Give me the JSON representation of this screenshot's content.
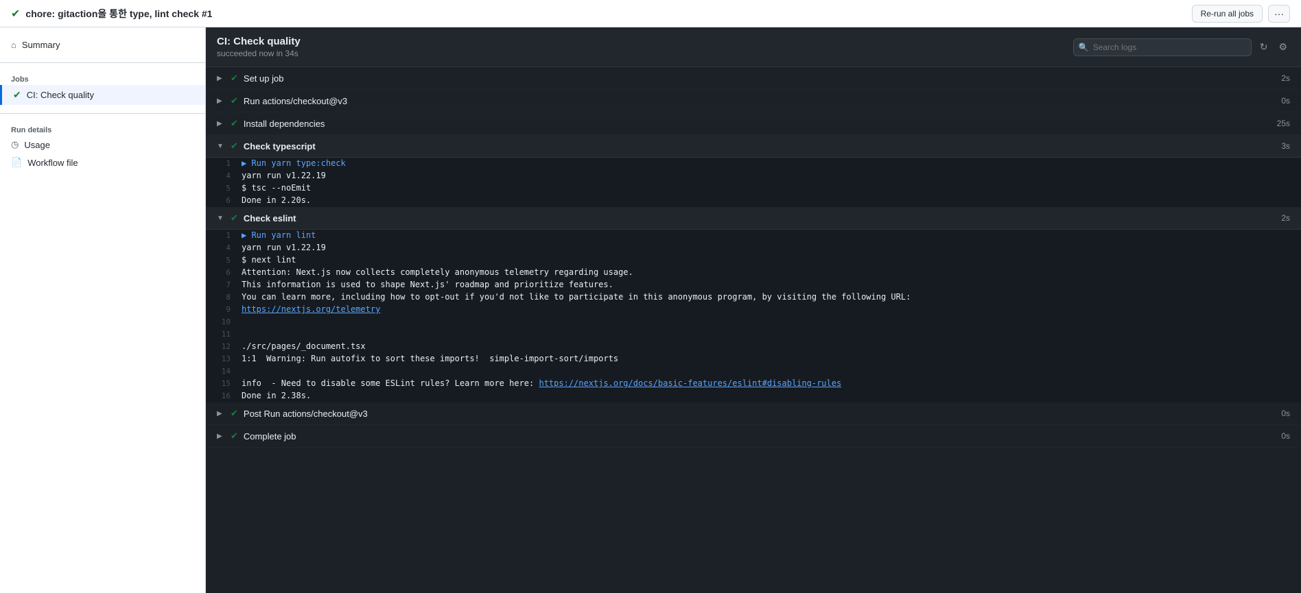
{
  "page": {
    "title": "chore: gitaction을 통한 type, lint check #1",
    "rerun_label": "Re-run all jobs",
    "more_label": "···"
  },
  "sidebar": {
    "summary_label": "Summary",
    "jobs_label": "Jobs",
    "job_item": "CI: Check quality",
    "run_details_label": "Run details",
    "usage_label": "Usage",
    "workflow_label": "Workflow file"
  },
  "job_panel": {
    "title": "CI: Check quality",
    "subtitle": "succeeded now in 34s",
    "search_placeholder": "Search logs"
  },
  "steps": [
    {
      "name": "Set up job",
      "time": "2s",
      "expanded": false
    },
    {
      "name": "Run actions/checkout@v3",
      "time": "0s",
      "expanded": false
    },
    {
      "name": "Install dependencies",
      "time": "25s",
      "expanded": false
    },
    {
      "name": "Check typescript",
      "time": "3s",
      "expanded": true,
      "lines": [
        {
          "num": 1,
          "content": "▶ Run yarn type:check",
          "type": "run"
        },
        {
          "num": 4,
          "content": "yarn run v1.22.19",
          "type": "normal"
        },
        {
          "num": 5,
          "content": "$ tsc --noEmit",
          "type": "normal"
        },
        {
          "num": 6,
          "content": "Done in 2.20s.",
          "type": "normal"
        }
      ]
    },
    {
      "name": "Check eslint",
      "time": "2s",
      "expanded": true,
      "lines": [
        {
          "num": 1,
          "content": "▶ Run yarn lint",
          "type": "run"
        },
        {
          "num": 4,
          "content": "yarn run v1.22.19",
          "type": "normal"
        },
        {
          "num": 5,
          "content": "$ next lint",
          "type": "normal"
        },
        {
          "num": 6,
          "content": "Attention: Next.js now collects completely anonymous telemetry regarding usage.",
          "type": "normal"
        },
        {
          "num": 7,
          "content": "This information is used to shape Next.js' roadmap and prioritize features.",
          "type": "normal"
        },
        {
          "num": 8,
          "content": "You can learn more, including how to opt-out if you'd not like to participate in this anonymous program, by visiting the following URL:",
          "type": "normal"
        },
        {
          "num": 9,
          "content": "https://nextjs.org/telemetry",
          "type": "link"
        },
        {
          "num": 10,
          "content": "",
          "type": "normal"
        },
        {
          "num": 11,
          "content": "",
          "type": "normal"
        },
        {
          "num": 12,
          "content": "./src/pages/_document.tsx",
          "type": "normal"
        },
        {
          "num": 13,
          "content": "1:1  Warning: Run autofix to sort these imports!  simple-import-sort/imports",
          "type": "normal"
        },
        {
          "num": 14,
          "content": "",
          "type": "normal"
        },
        {
          "num": 15,
          "content": "info  - Need to disable some ESLint rules? Learn more here: https://nextjs.org/docs/basic-features/eslint#disabling-rules",
          "type": "link15"
        },
        {
          "num": 16,
          "content": "Done in 2.38s.",
          "type": "normal"
        }
      ]
    },
    {
      "name": "Post Run actions/checkout@v3",
      "time": "0s",
      "expanded": false
    },
    {
      "name": "Complete job",
      "time": "0s",
      "expanded": false
    }
  ]
}
